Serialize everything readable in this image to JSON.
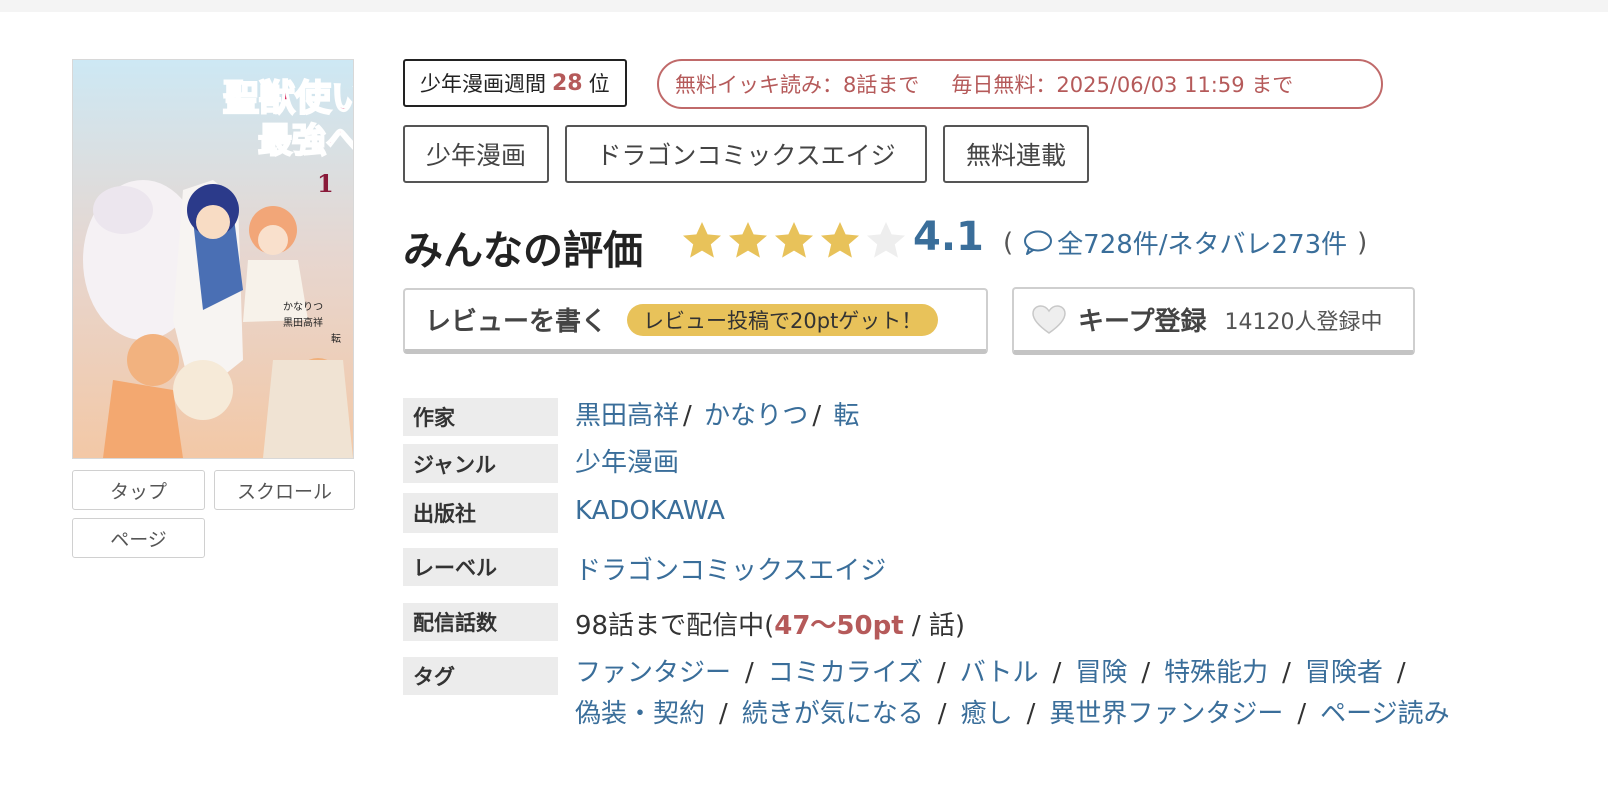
{
  "cover": {
    "alt": "幼馴染のS級パーティーから追放された聖獣使い。～万能支援魔法と仲間を増やして最強へ～ 1",
    "title_main": "聖獣使い。",
    "title_sub": "最強へ",
    "volume": "1",
    "authors_small": [
      "かなりつ",
      "黒田高祥",
      "転"
    ]
  },
  "viewer_buttons": {
    "tap": "タップ",
    "scroll": "スクロール",
    "page": "ページ"
  },
  "ranking": {
    "prefix": "少年漫画週間",
    "number": "28",
    "suffix": "位"
  },
  "free_info": {
    "text1": "無料イッキ読み：8話まで",
    "text2": "毎日無料：2025/06/03 11:59 まで"
  },
  "genre_tags": [
    "少年漫画",
    "ドラゴンコミックスエイジ",
    "無料連載"
  ],
  "rating": {
    "title": "みんなの評価",
    "score": "4.1",
    "score_value": 4.1,
    "max_stars": 5,
    "open_paren": "(",
    "close_paren": ")",
    "counts_text": "全728件/ネタバレ273件"
  },
  "review_button": {
    "label": "レビューを書く",
    "promo": "レビュー投稿で20ptゲット！"
  },
  "keep_button": {
    "label": "キープ登録",
    "count": "14120人登録中"
  },
  "info": {
    "author_label": "作家",
    "authors": [
      "黒田高祥",
      "かなりつ",
      "転"
    ],
    "genre_label": "ジャンル",
    "genre": "少年漫画",
    "publisher_label": "出版社",
    "publisher": "KADOKAWA",
    "label_label": "レーベル",
    "label": "ドラゴンコミックスエイジ",
    "episodes_label": "配信話数",
    "episodes_text": "98話まで配信中(",
    "episodes_pt": "47〜50pt",
    "episodes_unit": "/ 話)",
    "tags_label": "タグ",
    "tags_line1": [
      "ファンタジー",
      "コミカライズ",
      "バトル",
      "冒険",
      "特殊能力",
      "冒険者"
    ],
    "tags_line2": [
      "偽装・契約",
      "続きが気になる",
      "癒し",
      "異世界ファンタジー",
      "ページ読み"
    ]
  },
  "colors": {
    "link": "#3a6e9a",
    "accent_red": "#b55a5a",
    "star_gold": "#e8c25a",
    "star_empty": "#eeeeee",
    "promo_pill": "#e8c25a"
  },
  "icons": [
    "star-icon",
    "comment-bubble-icon",
    "heart-icon"
  ]
}
